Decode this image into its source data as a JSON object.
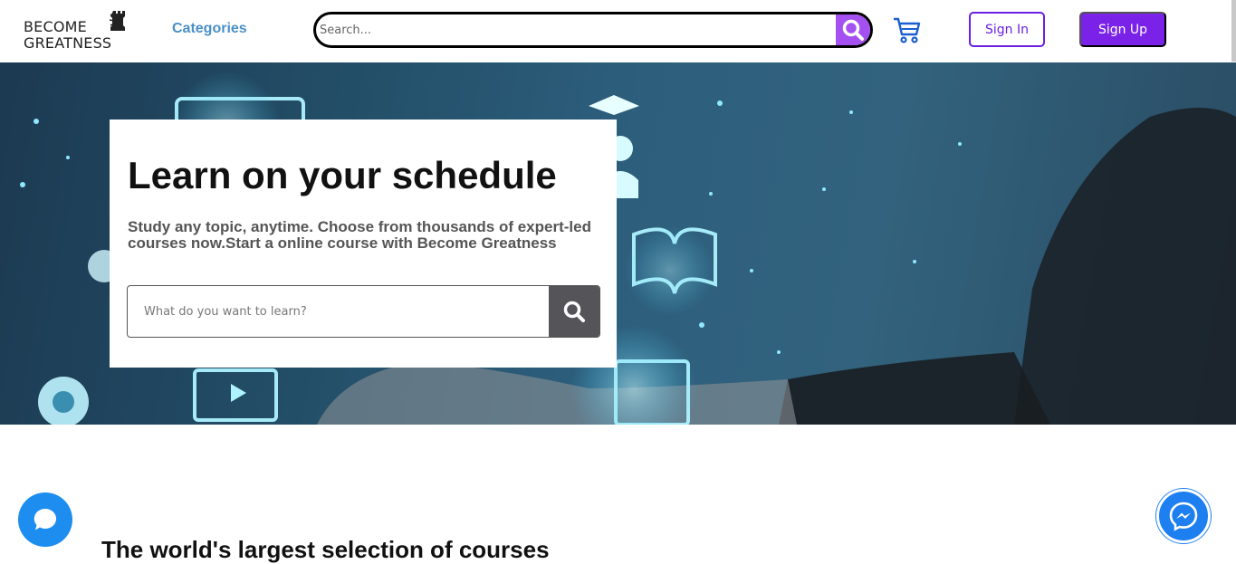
{
  "header": {
    "logo": {
      "line1": "BECOME",
      "line2": "GREATNESS"
    },
    "categories_label": "Categories",
    "search": {
      "placeholder": "Search...",
      "icon": "search-icon"
    },
    "cart_icon": "cart-icon",
    "signin_label": "Sign In",
    "signup_label": "Sign Up"
  },
  "hero": {
    "title": "Learn on your schedule",
    "subtitle": "Study any topic, anytime. Choose from thousands of expert-led courses now.Start a online course with Become Greatness",
    "search": {
      "placeholder": "What do you want to learn?",
      "icon": "search-icon"
    }
  },
  "section": {
    "title": "The world's largest selection of courses"
  },
  "floating": {
    "chat_icon": "chat-bubble-icon",
    "messenger_icon": "messenger-icon"
  },
  "colors": {
    "accent_purple": "#7a22e8",
    "search_button": "#a550f0",
    "link_blue": "#4a90c8",
    "chat_blue": "#1d8ef0"
  }
}
